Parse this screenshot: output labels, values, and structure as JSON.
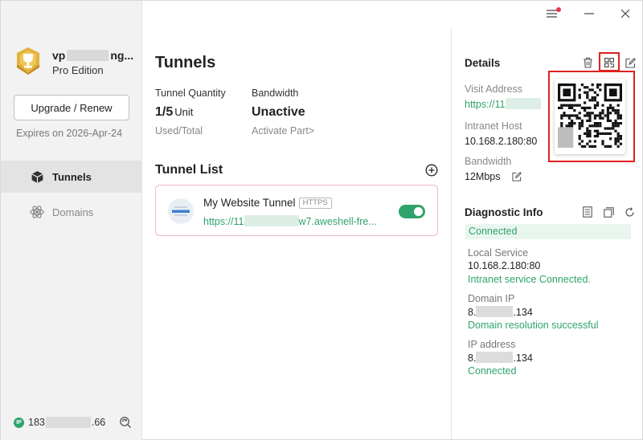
{
  "sidebar": {
    "user_name_prefix": "vp",
    "user_name_suffix": "ng...",
    "edition": "Pro Edition",
    "upgrade_label": "Upgrade / Renew",
    "expires": "Expires on 2026-Apr-24",
    "nav": [
      {
        "label": "Tunnels",
        "icon": "cube-icon",
        "active": true
      },
      {
        "label": "Domains",
        "icon": "atom-icon",
        "active": false
      }
    ],
    "ip_badge": "IP",
    "ip_prefix": "183",
    "ip_suffix": ".66"
  },
  "main": {
    "title": "Tunnels",
    "stats": [
      {
        "label": "Tunnel Quantity",
        "value": "1/5",
        "unit": "Unit",
        "sub": "Used/Total"
      },
      {
        "label": "Bandwidth",
        "value": "Unactive",
        "unit": "",
        "sub": "Activate Part>"
      }
    ],
    "list_title": "Tunnel List",
    "tunnels": [
      {
        "name": "My Website Tunnel",
        "protocol": "HTTPS",
        "url_prefix": "https://11",
        "url_suffix": "w7.aweshell-fre...",
        "enabled": true
      }
    ]
  },
  "details": {
    "title": "Details",
    "visit_label": "Visit Address",
    "visit_value_prefix": "https://11",
    "intranet_label": "Intranet Host",
    "intranet_value": "10.168.2.180:80",
    "bandwidth_label": "Bandwidth",
    "bandwidth_value": "12Mbps"
  },
  "diagnostic": {
    "title": "Diagnostic Info",
    "status": "Connected",
    "local_label": "Local Service",
    "local_value": "10.168.2.180:80",
    "local_status": "Intranet service Connected.",
    "domain_label": "Domain IP",
    "domain_prefix": "8.",
    "domain_suffix": ".134",
    "domain_status": "Domain resolution successful",
    "ip_label": "IP address",
    "ip_prefix": "8.",
    "ip_suffix": ".134",
    "ip_status": "Connected"
  },
  "colors": {
    "accent": "#2fa36b",
    "highlight": "#e02020",
    "notify": "#e8364e"
  }
}
